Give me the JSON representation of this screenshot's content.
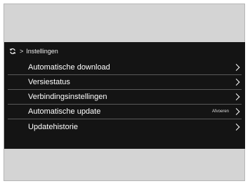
{
  "breadcrumb": {
    "icon": "sync-icon",
    "separator": ">",
    "title": "Instellingen"
  },
  "menu": {
    "items": [
      {
        "label": "Automatische download",
        "value": ""
      },
      {
        "label": "Versiestatus",
        "value": ""
      },
      {
        "label": "Verbindingsinstellingen",
        "value": ""
      },
      {
        "label": "Automatische update",
        "value": "Afvoeren"
      },
      {
        "label": "Updatehistorie",
        "value": ""
      }
    ]
  },
  "colors": {
    "screen_bg": "#141414",
    "frame_bg": "#d4d4d4",
    "divider": "#5a5a5a",
    "text": "#ffffff"
  }
}
